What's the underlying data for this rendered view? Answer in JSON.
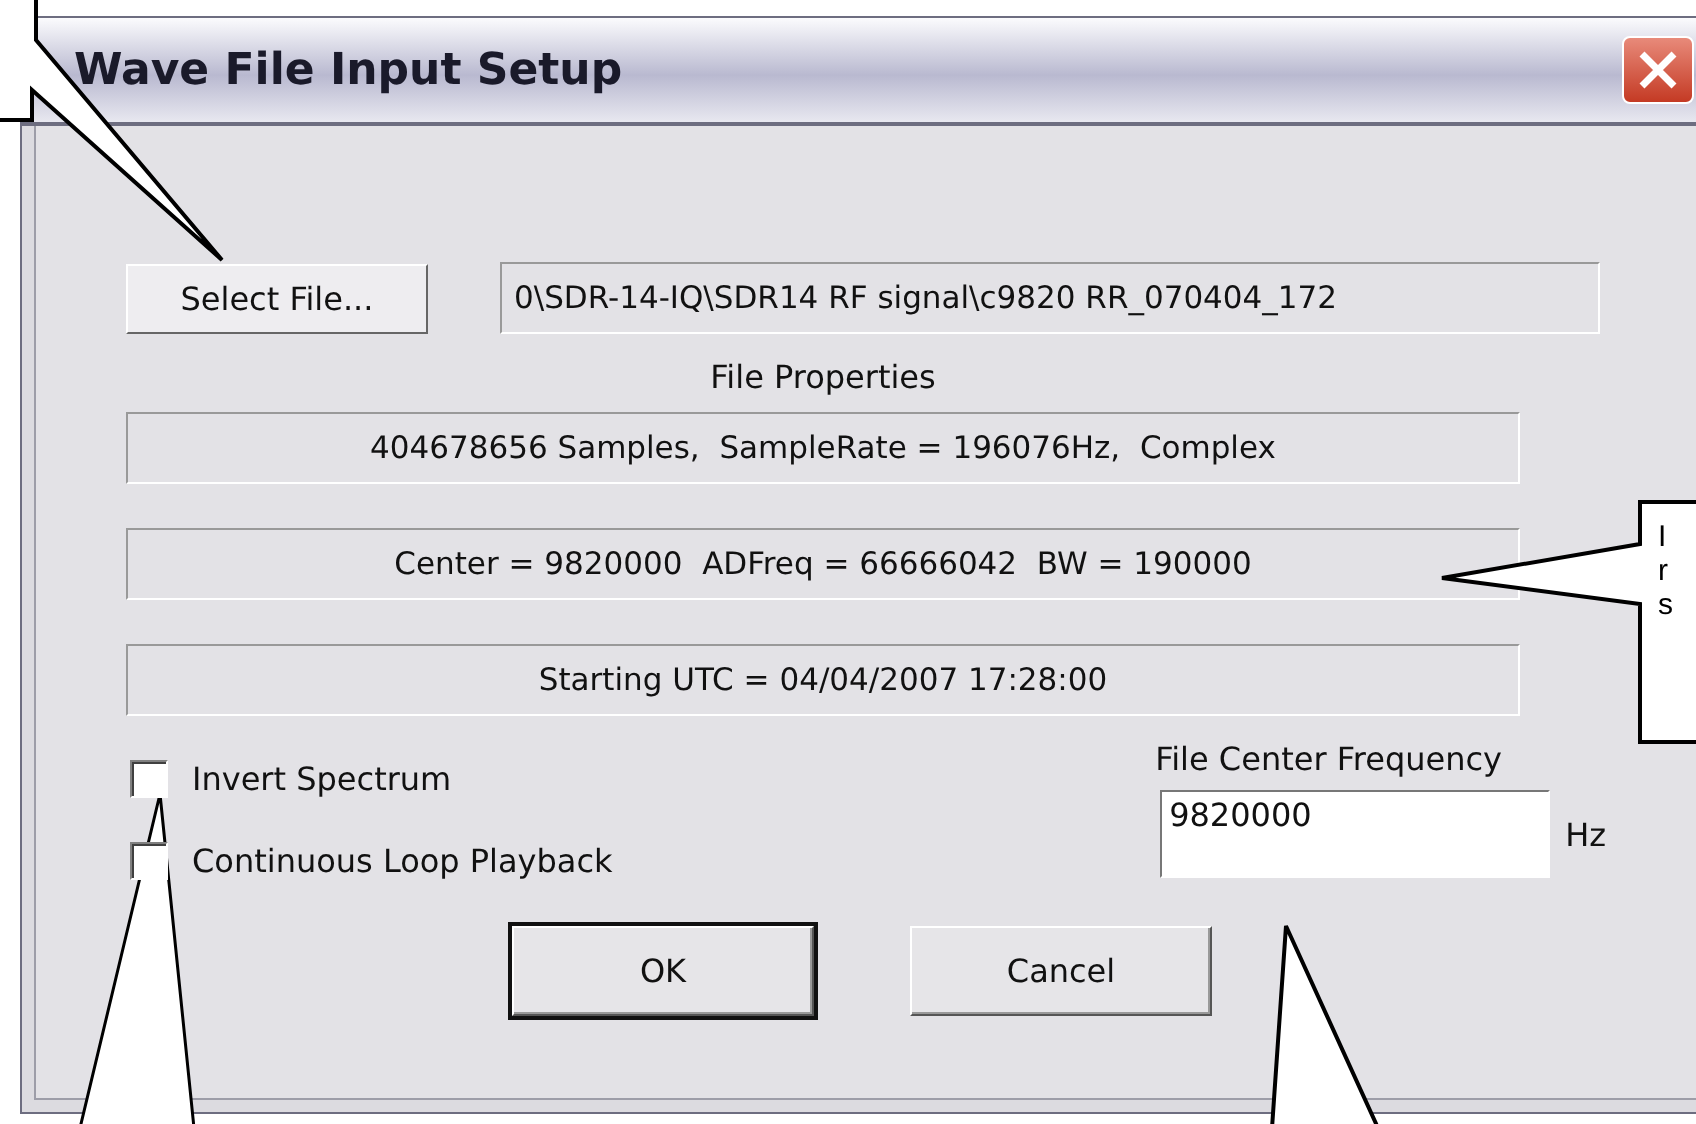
{
  "window": {
    "title": "Wave File Input Setup"
  },
  "select_file_button": "Select File...",
  "file_path": "0\\SDR-14-IQ\\SDR14  RF signal\\c9820 RR_070404_172",
  "file_properties": {
    "label": "File Properties",
    "lines": [
      "404678656 Samples,  SampleRate = 196076Hz,  Complex",
      "Center = 9820000  ADFreq = 66666042  BW = 190000",
      "Starting UTC = 04/04/2007 17:28:00"
    ]
  },
  "checkboxes": [
    {
      "label": "Invert Spectrum",
      "checked": false
    },
    {
      "label": "Continuous Loop Playback",
      "checked": false
    }
  ],
  "center_frequency": {
    "label": "File Center Frequency",
    "value": "9820000",
    "unit": "Hz"
  },
  "buttons": [
    {
      "label": "OK",
      "default": true
    },
    {
      "label": "Cancel",
      "default": false
    }
  ],
  "annotation": {
    "lines": [
      "I",
      "r",
      "s"
    ]
  }
}
